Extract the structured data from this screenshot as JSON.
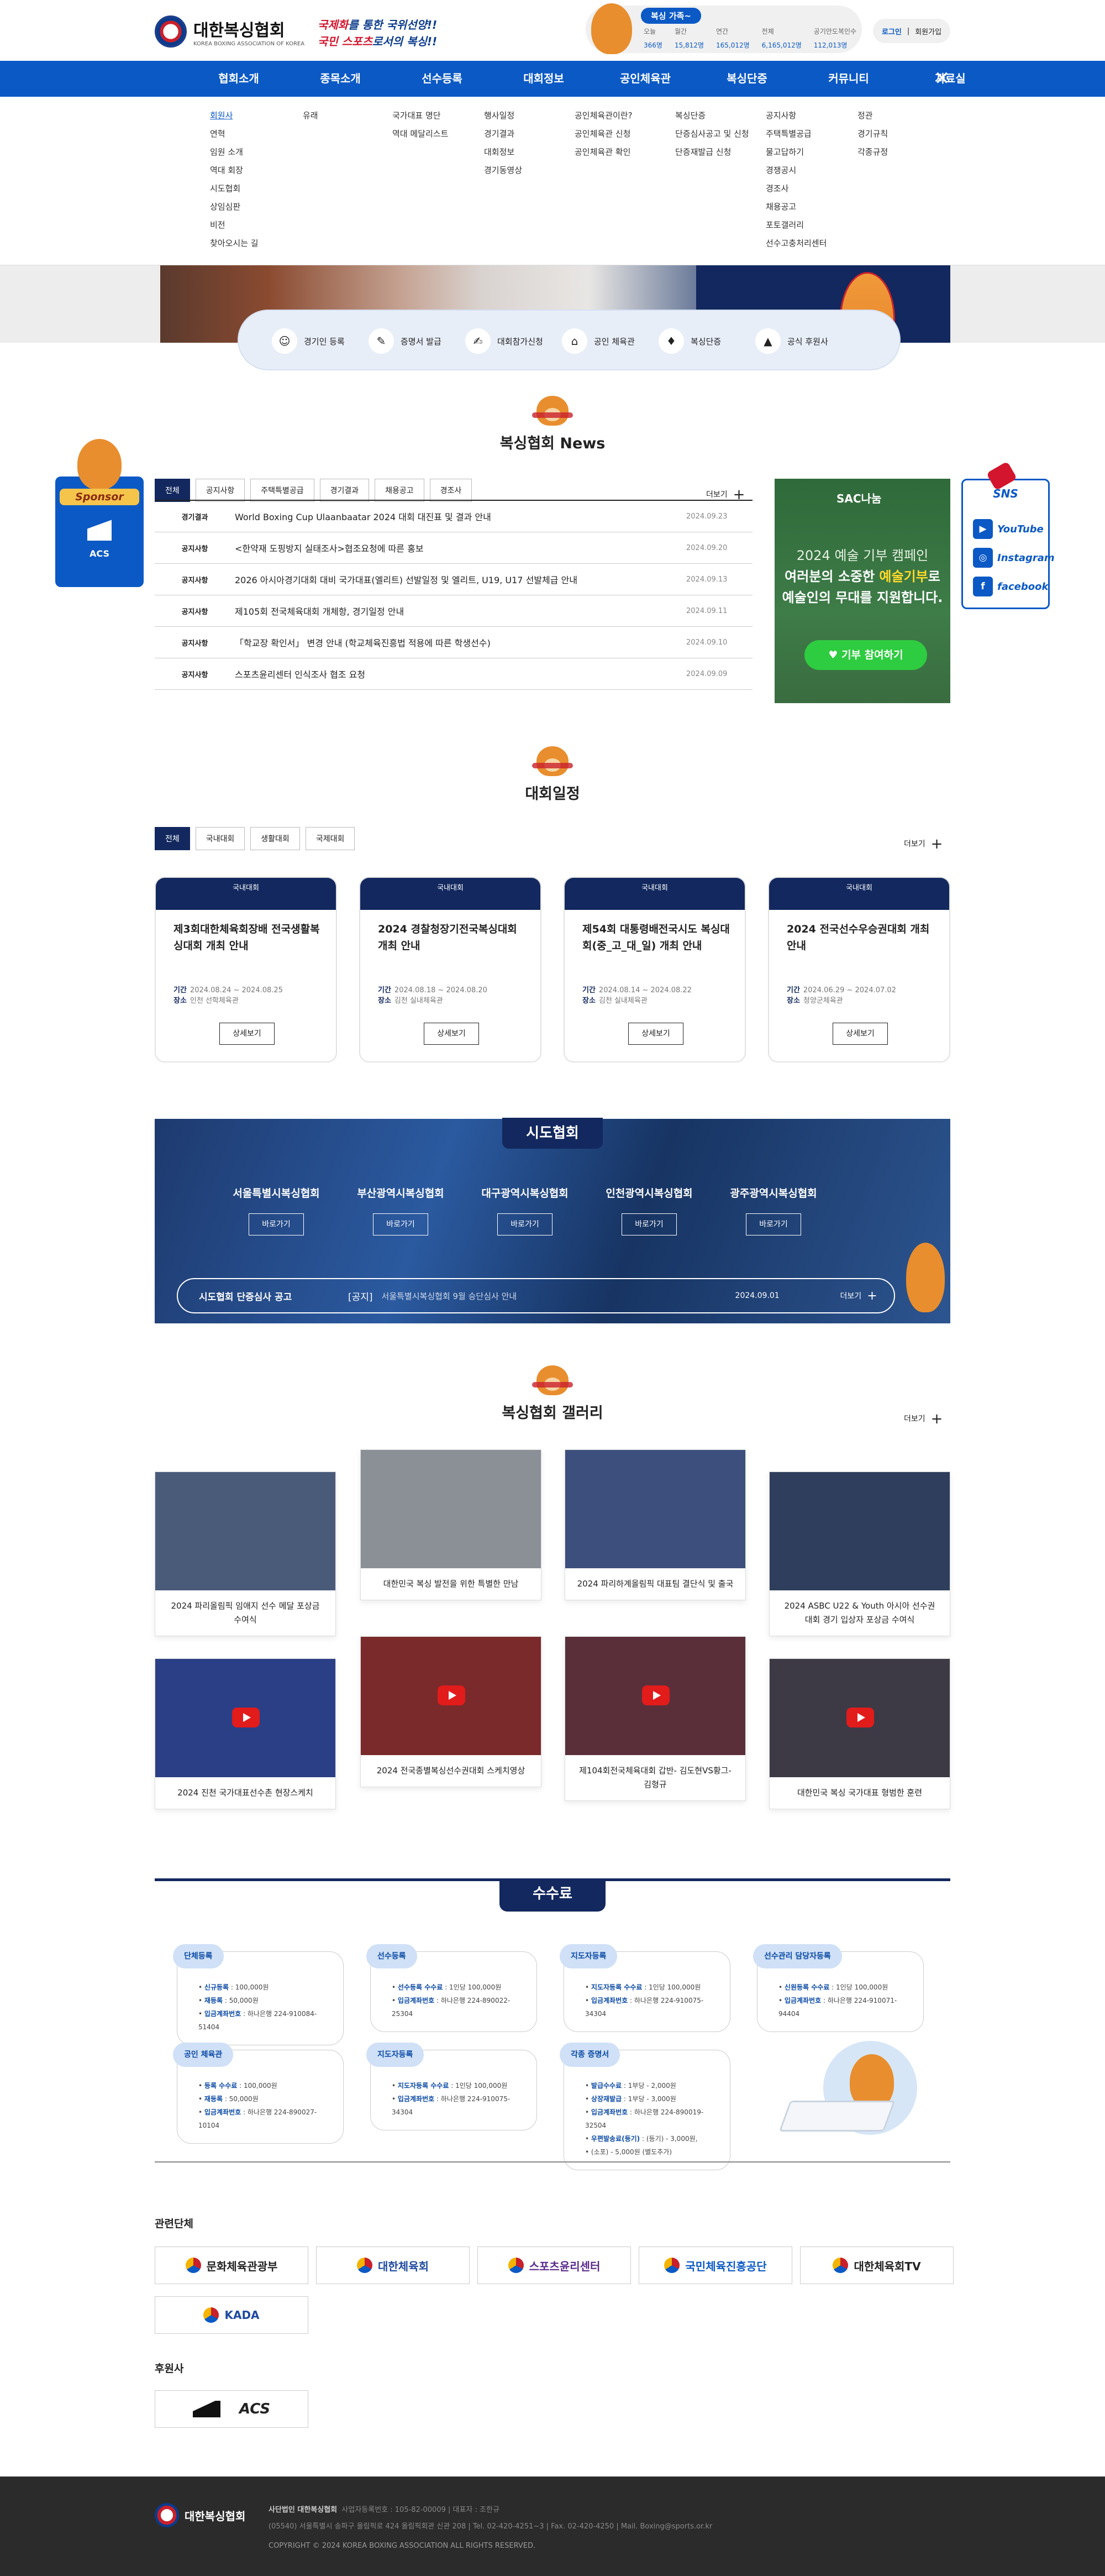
{
  "header": {
    "logo_ko": "대한복싱협회",
    "logo_en": "KOREA BOXING ASSOCIATION OF KOREA",
    "slogan_line1_a": "국제화",
    "slogan_line1_b": "를 통한 국위선양!!",
    "slogan_line2_a": "국민 스포츠",
    "slogan_line2_b": "로서의 복싱!!",
    "family_tag": "복싱 가족~",
    "family_stats": [
      {
        "k": "오늘",
        "v": "366명"
      },
      {
        "k": "월간",
        "v": "15,812명"
      },
      {
        "k": "연간",
        "v": "165,012명"
      },
      {
        "k": "전체",
        "v": "6,165,012명"
      },
      {
        "k": "공기안도복인수",
        "v": "112,013명"
      }
    ],
    "login": "로그인",
    "join": "회원가입"
  },
  "nav": {
    "items": [
      "협회소개",
      "종목소개",
      "선수등록",
      "대회정보",
      "공인체육관",
      "복싱단증",
      "커뮤니티",
      "자료실"
    ],
    "close": "✕"
  },
  "mega": [
    [
      "회원사",
      "연혁",
      "임원 소개",
      "역대 회장",
      "시도협회",
      "상임심판",
      "비전",
      "찾아오시는 길"
    ],
    [
      "유래"
    ],
    [
      "국가대표 명단",
      "역대 메달리스트"
    ],
    [
      "행사일정",
      "경기결과",
      "대회정보",
      "경기동영상"
    ],
    [
      "공인체육관이란?",
      "공인체육관 신청",
      "공인체육관 확인"
    ],
    [
      "복싱단증",
      "단증심사공고 및 신청",
      "단증재발급 신청"
    ],
    [
      "공지사항",
      "주택특별공급",
      "물고답하기",
      "경쟁공시",
      "경조사",
      "채용공고",
      "포토갤러리",
      "선수고충처리센터"
    ],
    [
      "정관",
      "경기규칙",
      "각종규정"
    ]
  ],
  "quick": [
    {
      "icon": "id-card-icon",
      "glyph": "☺",
      "label": "경기인 등록"
    },
    {
      "icon": "certificate-icon",
      "glyph": "✎",
      "label": "증명서 발급"
    },
    {
      "icon": "entry-form-icon",
      "glyph": "✍",
      "label": "대회참가신청"
    },
    {
      "icon": "gym-icon",
      "glyph": "⌂",
      "label": "공인 체육관"
    },
    {
      "icon": "dan-icon",
      "glyph": "♦",
      "label": "복싱단증"
    },
    {
      "icon": "adidas-icon",
      "glyph": "▲",
      "label": "공식 후원사"
    }
  ],
  "news": {
    "title": "복싱협회 News",
    "tabs": [
      "전체",
      "공지사항",
      "주택특별공급",
      "경기결과",
      "채용공고",
      "경조사"
    ],
    "more": "더보기",
    "rows": [
      {
        "cat": "경기결과",
        "title": "World Boxing Cup Ulaanbaatar 2024 대회 대진표 및 결과 안내",
        "date": "2024.09.23"
      },
      {
        "cat": "공지사항",
        "title": "<한약재 도핑방지 실태조사>협조요청에 따른 홍보",
        "date": "2024.09.20"
      },
      {
        "cat": "공지사항",
        "title": "2026 아시아경기대회 대비 국가대표(엘리트) 선발일정 및 엘리트, U19, U17 선발체급 안내",
        "date": "2024.09.13"
      },
      {
        "cat": "공지사항",
        "title": "제105회 전국체육대회 개체항, 경기일정 안내",
        "date": "2024.09.11"
      },
      {
        "cat": "공지사항",
        "title": "「학교장 확인서」 변경 안내 (학교체육진흥법 적용에 따른 학생선수)",
        "date": "2024.09.10"
      },
      {
        "cat": "공지사항",
        "title": "스포츠윤리센터 인식조사 협조 요청",
        "date": "2024.09.09"
      }
    ]
  },
  "sac": {
    "logo": "SAC나눔",
    "line1": "2024 예술 기부 캠페인",
    "line2a": "여러분의 소중한 ",
    "line2b": "예술기부",
    "line2c": "로",
    "line3": "예술인의 무대를 지원합니다.",
    "button": "기부 참여하기"
  },
  "sponsor": {
    "tag": "Sponsor",
    "name": "ACS"
  },
  "sns": {
    "title": "SNS",
    "items": [
      "YouTube",
      "Instagram",
      "facebook"
    ]
  },
  "schedule": {
    "title": "대회일정",
    "tabs": [
      "전체",
      "국내대회",
      "생활대회",
      "국제대회"
    ],
    "more": "더보기",
    "cards": [
      {
        "tag": "국내대회",
        "title": "제3회대한체육회장배 전국생활복싱대회 개최 안내",
        "period_k": "기간",
        "period": "2024.08.24 ~ 2024.08.25",
        "place_k": "장소",
        "place": "인천 선학체육관",
        "btn": "상세보기"
      },
      {
        "tag": "국내대회",
        "title": "2024 경찰청장기전국복싱대회 개최 안내",
        "period_k": "기간",
        "period": "2024.08.18 ~ 2024.08.20",
        "place_k": "장소",
        "place": "김천 실내체육관",
        "btn": "상세보기"
      },
      {
        "tag": "국내대회",
        "title": "제54회 대통령배전국시도 복싱대회(중_고_대_일) 개최 안내",
        "period_k": "기간",
        "period": "2024.08.14 ~ 2024.08.22",
        "place_k": "장소",
        "place": "김천 실내체육관",
        "btn": "상세보기"
      },
      {
        "tag": "국내대회",
        "title": "2024 전국선수우승권대회 개최 안내",
        "period_k": "기간",
        "period": "2024.06.29 ~ 2024.07.02",
        "place_k": "장소",
        "place": "청양군체육관",
        "btn": "상세보기"
      }
    ]
  },
  "city": {
    "title": "시도협회",
    "items": [
      "서울특별시복싱협회",
      "부산광역시복싱협회",
      "대구광역시복싱협회",
      "인천광역시복싱협회",
      "광주광역시복싱협회"
    ],
    "btn": "바로가기",
    "bar_label": "시도협회 단증심사 공고",
    "bar_tag": "[공지]",
    "bar_title": "서울특별시복싱협회 9월 승단심사 안내",
    "bar_date": "2024.09.01",
    "bar_more": "더보기"
  },
  "gallery": {
    "title": "복싱협회 갤러리",
    "more": "더보기",
    "items": [
      {
        "cap": "2024 파리올림픽 임애지 선수 메달 포상금 수여식",
        "bg": "#4a5b7a"
      },
      {
        "cap": "대한민국 복싱 발전을 위한 특별한 만남",
        "bg": "#8b8f96"
      },
      {
        "cap": "2024 파리하계올림픽 대표팀 결단식 및 출국",
        "bg": "#3c4f7d"
      },
      {
        "cap": "2024 ASBC U22 & Youth 아시아 선수권대회 경기 입상자 포상금 수여식",
        "bg": "#2f3e5c"
      },
      {
        "cap": "2024 진천 국가대표선수촌 현장스케치",
        "bg": "#2b3f86",
        "video": true
      },
      {
        "cap": "2024 전국종별복싱선수권대회 스케치영상",
        "bg": "#7a2a2a",
        "video": true
      },
      {
        "cap": "제104회전국체육대회 갑반- 김도현VS황그-김형규",
        "bg": "#5a2f3a",
        "video": true
      },
      {
        "cap": "대한민국 복싱 국가대표 형범한 훈련",
        "bg": "#3d3a46",
        "video": true
      }
    ]
  },
  "fee": {
    "title": "수수료",
    "boxes": [
      {
        "tag": "단체등록",
        "lines": [
          [
            "신규등록",
            " : 100,000원"
          ],
          [
            "재등록",
            " : 50,000원"
          ],
          [
            "입금계좌번호",
            " : 하나은행 224-910084-51404"
          ]
        ]
      },
      {
        "tag": "선수등록",
        "lines": [
          [
            "선수등록 수수료",
            " : 1인당 100,000원"
          ],
          [
            "입금계좌번호",
            " : 하나은행 224-890022-25304"
          ]
        ]
      },
      {
        "tag": "지도자등록",
        "lines": [
          [
            "지도자등록 수수료",
            " : 1인당 100,000원"
          ],
          [
            "입금계좌번호",
            " : 하나은행 224-910075-34304"
          ]
        ]
      },
      {
        "tag": "선수관리 담당자등록",
        "lines": [
          [
            "신원등록 수수료",
            " : 1인당 100,000원"
          ],
          [
            "입금계좌번호",
            " : 하나은행 224-910071-94404"
          ]
        ]
      },
      {
        "tag": "공인 체육관",
        "lines": [
          [
            "등록 수수료",
            " : 100,000원"
          ],
          [
            "재등록",
            " : 50,000원"
          ],
          [
            "입금계좌번호",
            " : 하나은행 224-890027-10104"
          ]
        ]
      },
      {
        "tag": "지도자등록",
        "lines": [
          [
            "지도자등록 수수료",
            " : 1인당 100,000원"
          ],
          [
            "입금계좌번호",
            " : 하나은행 224-910075-34304"
          ]
        ]
      },
      {
        "tag": "각종 증명서",
        "lines": [
          [
            "발급수수료",
            " : 1부당 - 2,000원"
          ],
          [
            "상장재발급",
            " : 1부당 - 3,000원"
          ],
          [
            "입금계좌번호",
            " : 하나은행 224-890019-32504"
          ],
          [
            "우편발송료(등기)",
            " : (등기) - 3,000원,"
          ],
          [
            "",
            "(소포) - 5,000원 (별도추가)"
          ]
        ]
      }
    ]
  },
  "related": {
    "title": "관련단체",
    "items": [
      "문화체육관광부",
      "대한체육회",
      "스포츠윤리센터",
      "국민체육진흥공단",
      "대한체육회TV",
      "KADA"
    ],
    "sponsor_title": "후원사",
    "sponsors": [
      "adidas",
      "ACS"
    ]
  },
  "footer": {
    "logo": "대한복싱협회",
    "line1a": "사단법인 대한복싱협회",
    "line1b": "사업자등록번호 : 105-82-00009  |  대표자 : 조한규",
    "line2": "(05540) 서울특별시 송파구 올림픽로 424 올림픽회관 신관 208  |  Tel. 02-420-4251~3  |  Fax. 02-420-4250  |  Mail. Boxing@sports.or.kr",
    "copy": "COPYRIGHT © 2024 KOREA BOXING ASSOCIATION ALL RIGHTS RESERVED."
  }
}
